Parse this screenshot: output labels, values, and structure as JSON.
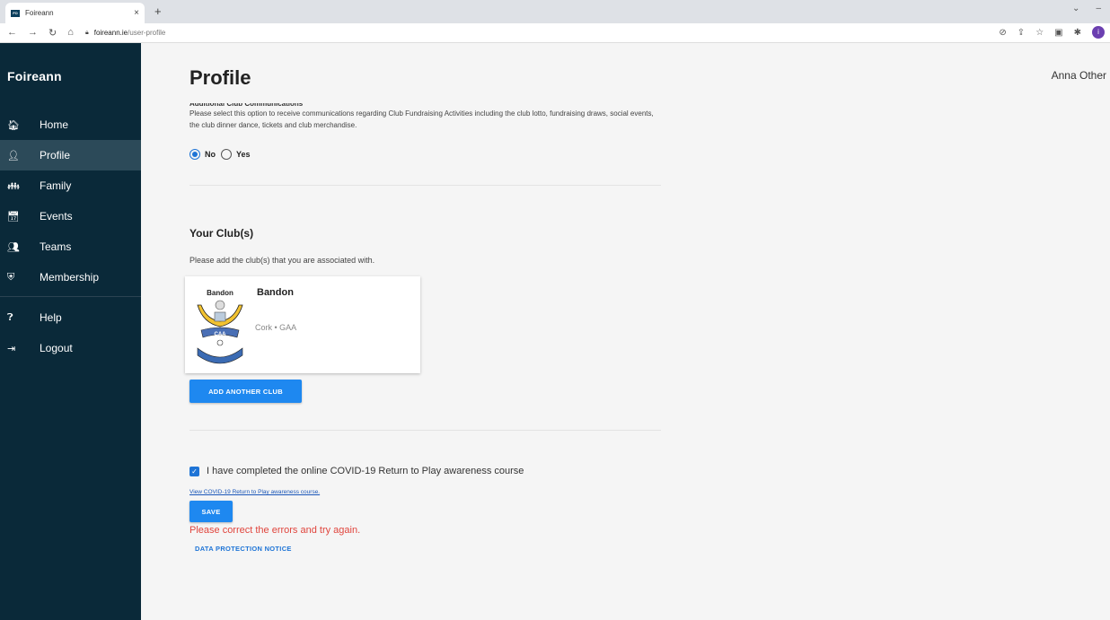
{
  "browser": {
    "tab_title": "Foireann",
    "tab_close": "×",
    "new_tab": "+",
    "url_domain": "foireann.ie",
    "url_path": "/user-profile",
    "profile_initial": "i"
  },
  "sidebar": {
    "brand": "Foireann",
    "items": [
      {
        "label": "Home",
        "icon": "home-icon",
        "glyph": "🏠︎"
      },
      {
        "label": "Profile",
        "icon": "person-icon",
        "glyph": "👤︎"
      },
      {
        "label": "Family",
        "icon": "family-icon",
        "glyph": "👪︎"
      },
      {
        "label": "Events",
        "icon": "calendar-icon",
        "glyph": "📅︎"
      },
      {
        "label": "Teams",
        "icon": "group-icon",
        "glyph": "👥︎"
      },
      {
        "label": "Membership",
        "icon": "shield-icon",
        "glyph": "⛨"
      },
      {
        "label": "Help",
        "icon": "help-icon",
        "glyph": "❓︎"
      },
      {
        "label": "Logout",
        "icon": "logout-icon",
        "glyph": "⇥"
      }
    ],
    "active_index": 1
  },
  "header": {
    "page_title": "Profile",
    "user_name": "Anna Other"
  },
  "communications": {
    "heading": "Additional Club Communications",
    "text": "Please select this option to receive communications regarding Club Fundraising Activities including the club lotto, fundraising draws, social events, the club dinner dance, tickets and club merchandise.",
    "option_no": "No",
    "option_yes": "Yes",
    "selected": "No"
  },
  "clubs": {
    "title": "Your Club(s)",
    "description": "Please add the club(s) that you are associated with.",
    "list": [
      {
        "name": "Bandon",
        "meta": "Cork • GAA",
        "logo_text": "Bandon",
        "logo_sub": "CAA"
      }
    ],
    "add_button": "ADD ANOTHER CLUB"
  },
  "covid": {
    "checked": true,
    "label": "I have completed the online COVID-19 Return to Play awareness course",
    "link": "View COVID-19 Return to Play awareness course."
  },
  "actions": {
    "save": "SAVE",
    "error": "Please correct the errors and try again.",
    "data_protection": "DATA PROTECTION NOTICE"
  },
  "colors": {
    "sidebar_bg": "#0a2939",
    "active_bg": "#2c4a59",
    "primary": "#1e88f0",
    "error": "#e0453d"
  }
}
